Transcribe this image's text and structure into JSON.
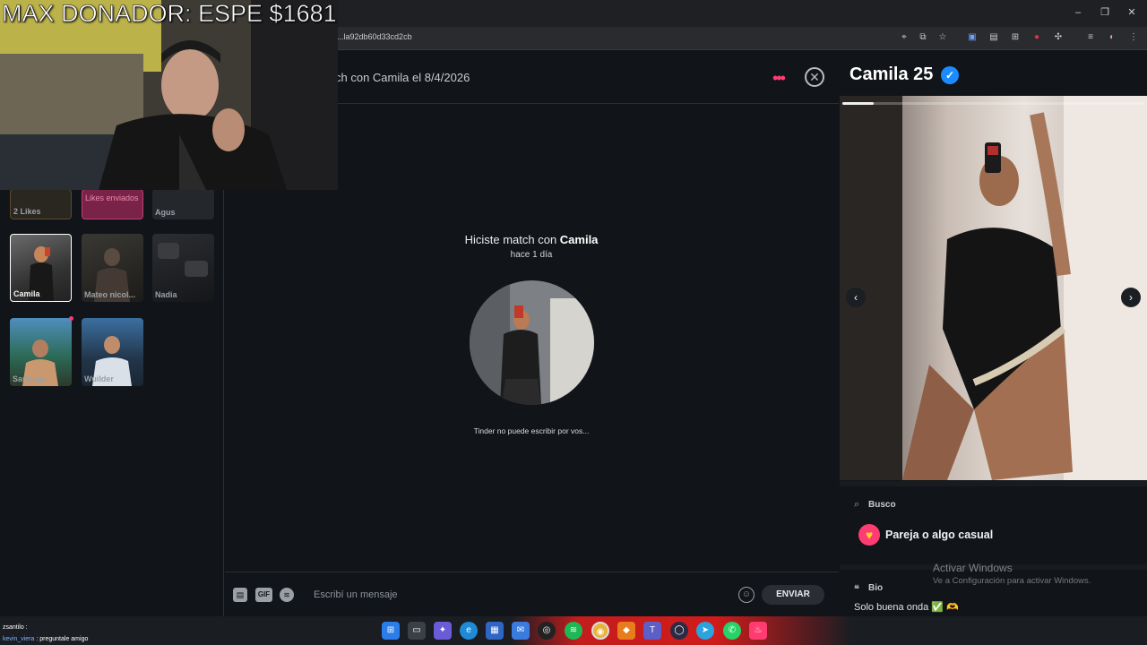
{
  "stream": {
    "donor_banner": "MAX DONADOR: ESPE $1681",
    "chat_lines": [
      {
        "user": "zsantilo :",
        "text": ""
      },
      {
        "user": "kevin_viera",
        "text": ": preguntale amigo"
      }
    ]
  },
  "browser": {
    "url": "...la92db60d33cd2cb",
    "window_controls": [
      "–",
      "❐",
      "✕"
    ]
  },
  "sidebar": {
    "top_row": [
      {
        "label": "2 Likes"
      },
      {
        "label": "Likes enviados"
      },
      {
        "label": "Agus"
      }
    ],
    "matches": [
      {
        "name": "Camila",
        "selected": true
      },
      {
        "name": "Mateo nicol...",
        "selected": false
      },
      {
        "name": "Nadia",
        "selected": false
      },
      {
        "name": "Santiago",
        "selected": false
      },
      {
        "name": "Wuilder",
        "selected": false
      }
    ]
  },
  "chat": {
    "header": "ch con Camila el 8/4/2026",
    "match_prefix": "Hiciste match con ",
    "match_name": "Camila",
    "match_time": "hace 1 día",
    "note": "Tinder no puede escribir por vos...",
    "composer_placeholder": "Escribí un mensaje",
    "gif_label": "GIF",
    "send_label": "ENVIAR"
  },
  "profile": {
    "name": "Camila",
    "age": "25",
    "photo_index": 1,
    "photo_count": 9,
    "looking_for_label": "Busco",
    "looking_for_value": "Pareja o algo casual",
    "bio_label": "Bio",
    "bio_text": "Solo buena onda ✅ 🫶"
  },
  "os": {
    "activate_title": "Activar Windows",
    "activate_sub": "Ve a Configuración para activar Windows."
  },
  "colors": {
    "brand": "#fe3c72",
    "verified": "#1a8cff",
    "background": "#111418"
  }
}
